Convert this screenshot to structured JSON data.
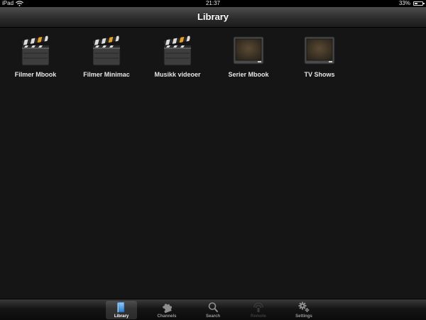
{
  "status_bar": {
    "carrier": "iPad",
    "time": "21:37",
    "battery": "33%"
  },
  "nav": {
    "title": "Library"
  },
  "items": [
    {
      "label": "Filmer Mbook",
      "icon": "clapperboard-icon"
    },
    {
      "label": "Filmer Minimac",
      "icon": "clapperboard-icon"
    },
    {
      "label": "Musikk videoer",
      "icon": "clapperboard-icon"
    },
    {
      "label": "Serier Mbook",
      "icon": "tv-icon"
    },
    {
      "label": "TV Shows",
      "icon": "tv-icon"
    }
  ],
  "tabs": [
    {
      "label": "Library",
      "icon": "library-icon",
      "selected": true
    },
    {
      "label": "Channels",
      "icon": "puzzle-icon"
    },
    {
      "label": "Search",
      "icon": "search-icon"
    },
    {
      "label": "Remote",
      "icon": "remote-icon",
      "disabled": true
    },
    {
      "label": "Settings",
      "icon": "gear-icon"
    }
  ],
  "colors": {
    "background": "#151515",
    "clapper_stripe": "#e8a020",
    "tv_screen": "#3b3022"
  }
}
